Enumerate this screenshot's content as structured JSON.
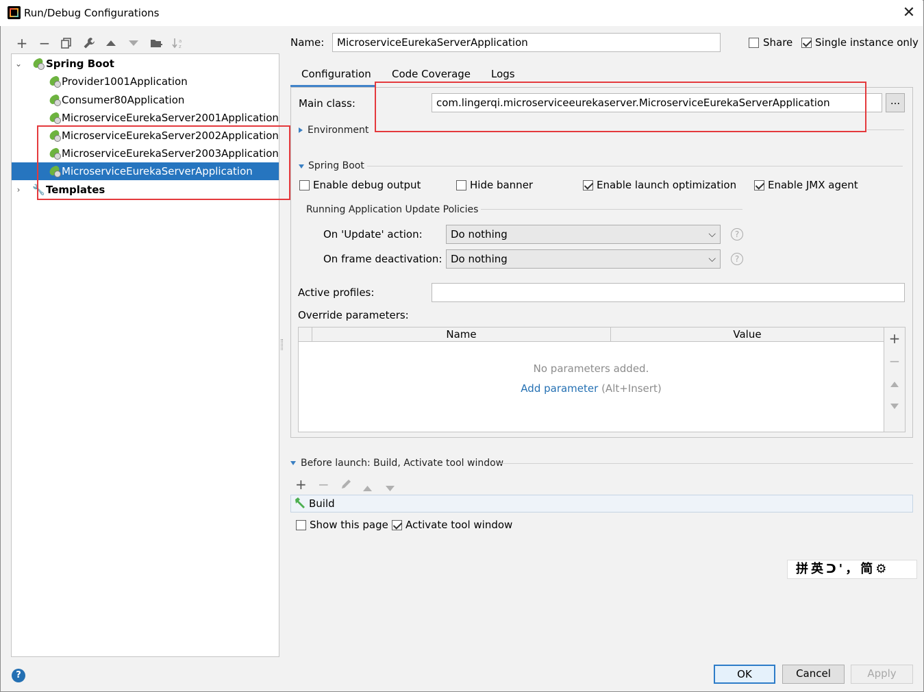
{
  "window": {
    "title": "Run/Debug Configurations"
  },
  "toolbar": {
    "icons": [
      "plus-icon",
      "minus-icon",
      "copy-icon",
      "wrench-icon",
      "arrow-up-icon",
      "arrow-down-icon",
      "folder-add-icon",
      "sort-icon"
    ]
  },
  "tree": {
    "spring_boot": "Spring Boot",
    "items": [
      "Provider1001Application",
      "Consumer80Application",
      "MicroserviceEurekaServer2001Application",
      "MicroserviceEurekaServer2002Application",
      "MicroserviceEurekaServer2003Application",
      "MicroserviceEurekaServerApplication"
    ],
    "selected": "MicroserviceEurekaServerApplication",
    "templates": "Templates"
  },
  "header": {
    "name_label": "Name:",
    "name_value": "MicroserviceEurekaServerApplication",
    "share_label": "Share",
    "share_checked": false,
    "single_instance_label": "Single instance only",
    "single_instance_checked": true
  },
  "tabs": [
    "Configuration",
    "Code Coverage",
    "Logs"
  ],
  "active_tab": "Configuration",
  "config": {
    "main_class_label": "Main class:",
    "main_class_value": "com.lingerqi.microserviceeurekaserver.MicroserviceEurekaServerApplication",
    "browse_label": "...",
    "environment_label": "Environment",
    "spring_boot_label": "Spring Boot",
    "enable_debug_label": "Enable debug output",
    "enable_debug_checked": false,
    "hide_banner_label": "Hide banner",
    "hide_banner_checked": false,
    "launch_opt_label": "Enable launch optimization",
    "launch_opt_checked": true,
    "jmx_label": "Enable JMX agent",
    "jmx_checked": true,
    "policies_label": "Running Application Update Policies",
    "on_update_label": "On 'Update' action:",
    "on_update_value": "Do nothing",
    "on_frame_label": "On frame deactivation:",
    "on_frame_value": "Do nothing",
    "help_glyph": "?",
    "active_profiles_label": "Active profiles:",
    "active_profiles_value": "",
    "override_label": "Override parameters:",
    "table_headers": [
      "Name",
      "Value"
    ],
    "empty_text": "No parameters added.",
    "add_param_link": "Add parameter",
    "add_param_hint": "(Alt+Insert)"
  },
  "before_launch": {
    "label": "Before launch: Build, Activate tool window",
    "task": "Build",
    "show_page_label": "Show this page",
    "show_page_checked": false,
    "activate_label": "Activate tool window",
    "activate_checked": true
  },
  "ime_bar": "拼英ᑐ'，简⚙",
  "buttons": {
    "ok": "OK",
    "cancel": "Cancel",
    "apply": "Apply"
  },
  "colors": {
    "selection": "#2675bf",
    "highlight_box": "#e4393c",
    "link": "#2470b3",
    "spring_leaf": "#6db33f"
  }
}
